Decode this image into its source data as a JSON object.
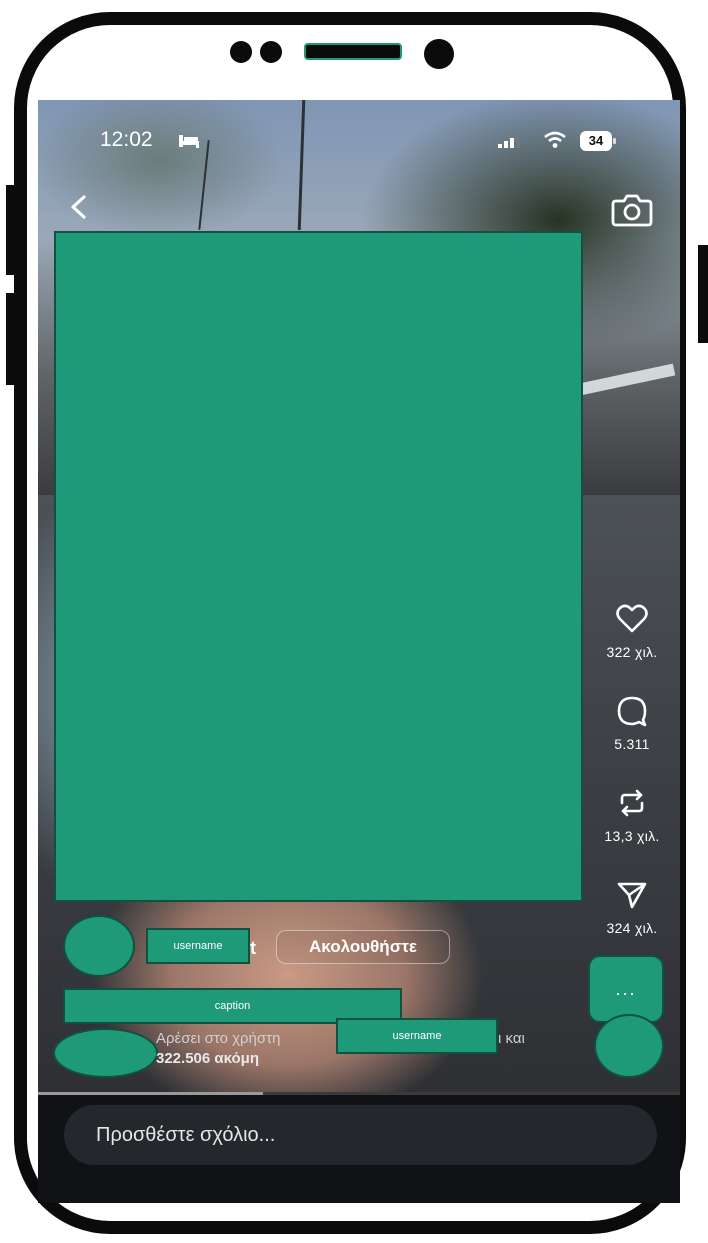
{
  "status_bar": {
    "time": "12:02",
    "battery": "34",
    "icons": [
      "bed-icon",
      "signal-icon",
      "wifi-icon",
      "battery-icon"
    ]
  },
  "header": {
    "back_icon": "chevron-left-icon",
    "camera_icon": "camera-icon"
  },
  "actions": {
    "like_count": "322 χιλ.",
    "comment_count": "5.311",
    "repost_count": "13,3 χιλ.",
    "share_count": "324 χιλ.",
    "more_label": "..."
  },
  "post": {
    "username_redacted": "username",
    "username_tail": "t",
    "follow_label": "Ακολουθήστε",
    "caption_redacted": "caption",
    "likes_prefix": "Αρέσει στο χρήστη",
    "likes_liker_redacted": "username",
    "likes_suffix": "ι και",
    "likes_count": "322.506 ακόμη",
    "progress": 0.35
  },
  "comment_box": {
    "placeholder": "Προσθέστε σχόλιο..."
  },
  "colors": {
    "redaction": "#1e9a78",
    "background_bar": "#101215",
    "input_bg": "#24272b"
  }
}
